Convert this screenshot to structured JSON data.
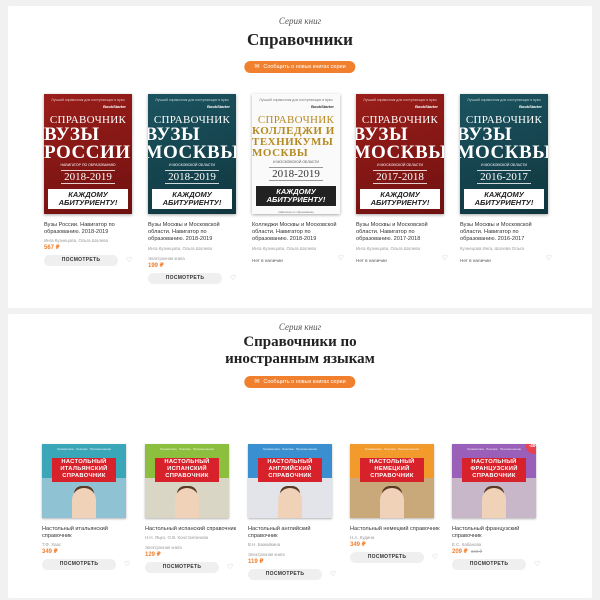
{
  "colors": {
    "accent": "#f07f2e",
    "sale": "#e9414b",
    "cover_red": "#d8222b"
  },
  "section1": {
    "series_label": "Серия книг",
    "title": "Справочники",
    "subscribe_label": "Сообщить о новых книгах серии",
    "cover_common": {
      "top_text": "Лучший справочник для поступающих в вузы",
      "brand": "BookStarter",
      "word1": "СПРАВОЧНИК",
      "slogan": "КАЖДОМУ АБИТУРИЕНТУ!",
      "bottom_text": "Навигатор по образованию"
    },
    "books": [
      {
        "cover_style": "red",
        "cover_word2": "ВУЗЫ РОССИИ",
        "cover_sub": "НАВИГАТОР ПО ОБРАЗОВАНИЮ",
        "cover_years": "2018-2019",
        "title": "Вузы России. Навигатор по образованию. 2018-2019",
        "author": "Инга Кузнецова, Ольга Шолева",
        "label": "",
        "price": "567 ₽",
        "old_price": "",
        "stock": "",
        "button": "ПОСМОТРЕТЬ"
      },
      {
        "cover_style": "teal",
        "cover_word2": "ВУЗЫ МОСКВЫ",
        "cover_sub": "И МОСКОВСКОЙ ОБЛАСТИ",
        "cover_years": "2018-2019",
        "title": "Вузы Москвы и Московской области. Навигатор по образованию. 2018-2019",
        "author": "Инга Кузнецова, Ольга Шолева",
        "label": "Электронная книга",
        "price": "199 ₽",
        "old_price": "",
        "stock": "",
        "button": "ПОСМОТРЕТЬ"
      },
      {
        "cover_style": "white",
        "cover_word2": "КОЛЛЕДЖИ И ТЕХНИКУМЫ МОСКВЫ",
        "cover_sub": "И МОСКОВСКОЙ ОБЛАСТИ",
        "cover_years": "2018-2019",
        "title": "Колледжи Москвы и Московской области. Навигатор по образованию. 2018-2019",
        "author": "Инга Кузнецова, Ольга Шолева",
        "label": "",
        "price": "",
        "old_price": "",
        "stock": "Нет в наличии",
        "button": ""
      },
      {
        "cover_style": "red",
        "cover_word2": "ВУЗЫ МОСКВЫ",
        "cover_sub": "И МОСКОВСКОЙ ОБЛАСТИ",
        "cover_years": "2017-2018",
        "title": "Вузы Москвы и Московской области. Навигатор по образованию. 2017-2018",
        "author": "Инга Кузнецова, Ольга Шолева",
        "label": "",
        "price": "",
        "old_price": "",
        "stock": "Нет в наличии",
        "button": ""
      },
      {
        "cover_style": "teal",
        "cover_word2": "ВУЗЫ МОСКВЫ",
        "cover_sub": "И МОСКОВСКОЙ ОБЛАСТИ",
        "cover_years": "2016-2017",
        "title": "Вузы Москвы и Московской области. Навигатор по образованию. 2016-2017",
        "author": "Кузнецова Инга, Шолева Ольга",
        "label": "",
        "price": "",
        "old_price": "",
        "stock": "Нет в наличии",
        "button": ""
      }
    ]
  },
  "section2": {
    "series_label": "Серия книг",
    "title_line1": "Справочники по",
    "title_line2": "иностранным языкам",
    "subscribe_label": "Сообщить о новых книгах серии",
    "cover_common": {
      "top_text": "Грамматика · Лексика · Произношение",
      "line1": "НАСТОЛЬНЫЙ",
      "line3": "СПРАВОЧНИК"
    },
    "books": [
      {
        "cover_bg": "#3aa7b9",
        "photo_bg": "#8fc2d3",
        "cover_lang": "ИТАЛЬЯНСКИЙ",
        "title": "Настольный итальянский справочник",
        "author": "Т.Ф. Хаас",
        "label": "",
        "price": "349 ₽",
        "old_price": "",
        "discount": "",
        "button": "ПОСМОТРЕТЬ"
      },
      {
        "cover_bg": "#8cbf3e",
        "photo_bg": "#d9d6c5",
        "cover_lang": "ИСПАНСКИЙ",
        "title": "Настольный испанский справочник",
        "author": "Н.Н. Яцко, О.В. Константинова",
        "label": "Электронная книга",
        "price": "129 ₽",
        "old_price": "",
        "discount": "",
        "button": "ПОСМОТРЕТЬ"
      },
      {
        "cover_bg": "#3a8fd1",
        "photo_bg": "#e2e4ea",
        "cover_lang": "АНГЛИЙСКИЙ",
        "title": "Настольный английский справочник",
        "author": "В.Н. Бажайкина",
        "label": "Электронная книга",
        "price": "119 ₽",
        "old_price": "",
        "discount": "",
        "button": "ПОСМОТРЕТЬ"
      },
      {
        "cover_bg": "#f29a2b",
        "photo_bg": "#c9a87a",
        "cover_lang": "НЕМЕЦКИЙ",
        "title": "Настольный немецкий справочник",
        "author": "Н.А. Кудина",
        "label": "",
        "price": "349 ₽",
        "old_price": "",
        "discount": "",
        "button": "ПОСМОТРЕТЬ"
      },
      {
        "cover_bg": "#9a5fb8",
        "photo_bg": "#c8b7c9",
        "cover_lang": "ФРАНЦУЗСКИЙ",
        "title": "Настольный французский справочник",
        "author": "Е.С. Кабанова",
        "label": "",
        "price": "209 ₽",
        "old_price": "349 ₽",
        "discount": "-40%",
        "button": "ПОСМОТРЕТЬ"
      }
    ]
  }
}
